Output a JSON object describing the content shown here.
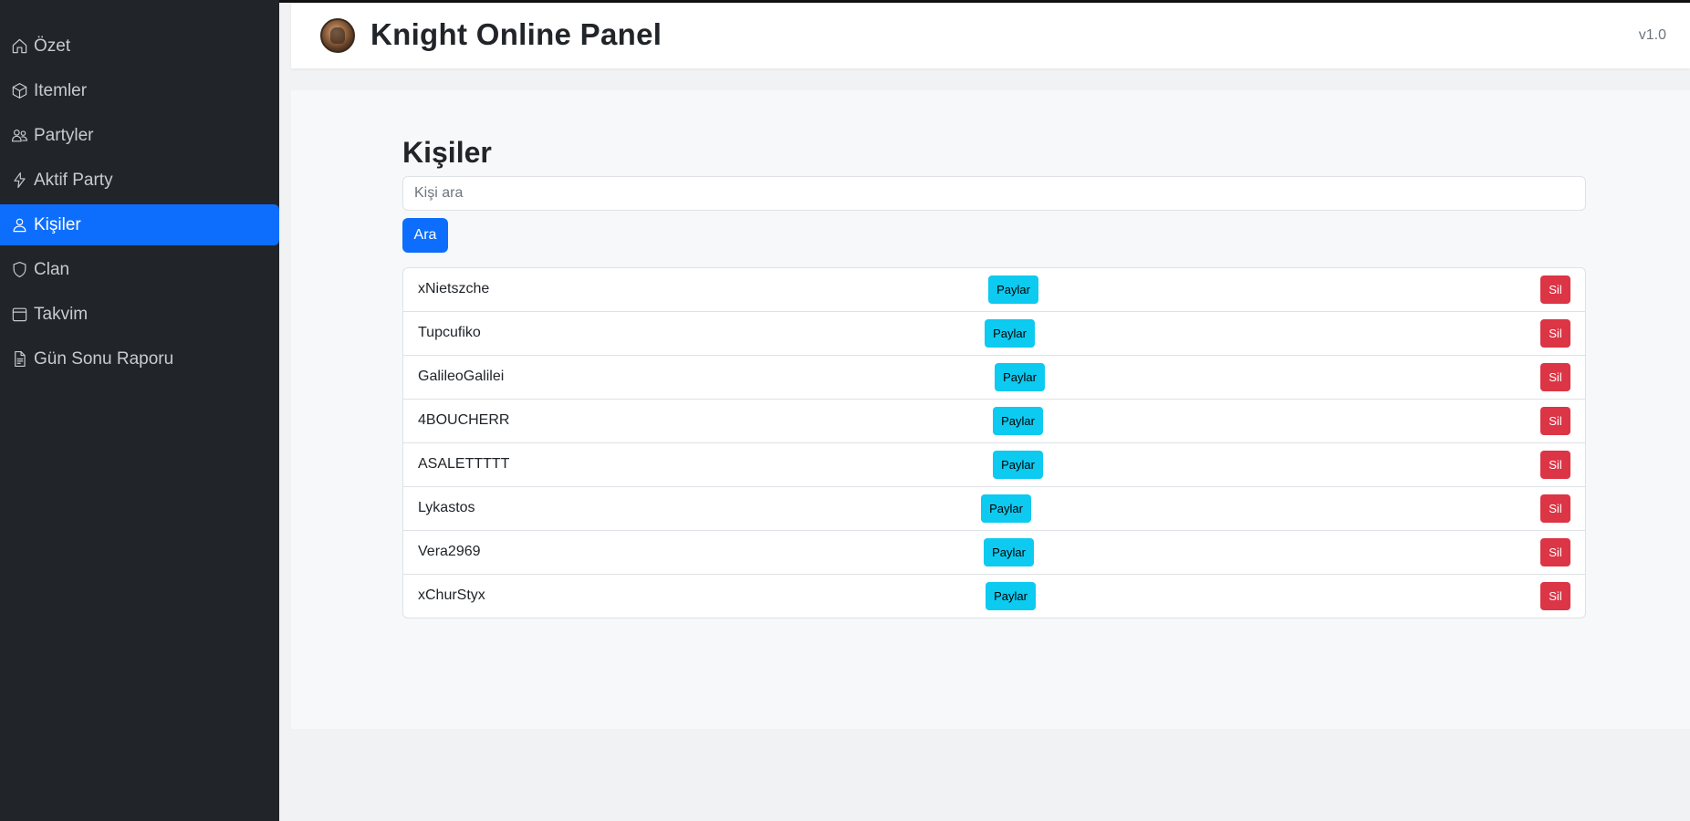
{
  "app": {
    "title": "Knight Online Panel",
    "version": "v1.0",
    "logo_icon": "knight-logo-icon"
  },
  "colors": {
    "sidebar_bg": "#212529",
    "active": "#0d6efd",
    "share": "#0dcaf0",
    "delete": "#dc3545"
  },
  "sidebar": {
    "items": [
      {
        "label": "Özet",
        "icon": "home-icon",
        "active": false
      },
      {
        "label": "Itemler",
        "icon": "box-icon",
        "active": false
      },
      {
        "label": "Partyler",
        "icon": "people-icon",
        "active": false
      },
      {
        "label": "Aktif Party",
        "icon": "lightning-icon",
        "active": false
      },
      {
        "label": "Kişiler",
        "icon": "person-icon",
        "active": true
      },
      {
        "label": "Clan",
        "icon": "shield-icon",
        "active": false
      },
      {
        "label": "Takvim",
        "icon": "calendar-icon",
        "active": false
      },
      {
        "label": "Gün Sonu Raporu",
        "icon": "document-icon",
        "active": false
      }
    ]
  },
  "main": {
    "title": "Kişiler",
    "search": {
      "placeholder": "Kişi ara",
      "value": "",
      "button_label": "Ara"
    },
    "people": [
      {
        "name": "xNietszche",
        "share_label": "Paylar",
        "delete_label": "Sil"
      },
      {
        "name": "Tupcufiko",
        "share_label": "Paylar",
        "delete_label": "Sil"
      },
      {
        "name": "GalileoGalilei",
        "share_label": "Paylar",
        "delete_label": "Sil"
      },
      {
        "name": "4BOUCHERR",
        "share_label": "Paylar",
        "delete_label": "Sil"
      },
      {
        "name": "ASALETTTTT",
        "share_label": "Paylar",
        "delete_label": "Sil"
      },
      {
        "name": "Lykastos",
        "share_label": "Paylar",
        "delete_label": "Sil"
      },
      {
        "name": "Vera2969",
        "share_label": "Paylar",
        "delete_label": "Sil"
      },
      {
        "name": "xChurStyx",
        "share_label": "Paylar",
        "delete_label": "Sil"
      }
    ]
  }
}
